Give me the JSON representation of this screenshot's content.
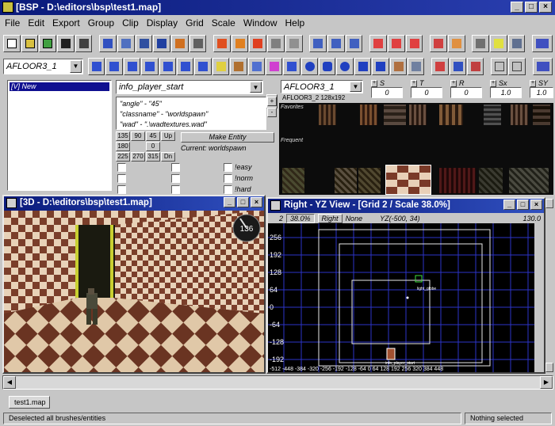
{
  "app": {
    "title": "[BSP - D:\\editors\\bsp\\test1.map]",
    "window_buttons": [
      "_",
      "□",
      "×"
    ]
  },
  "menu": [
    "File",
    "Edit",
    "Export",
    "Group",
    "Clip",
    "Display",
    "Grid",
    "Scale",
    "Window",
    "Help"
  ],
  "toolbar": {
    "texture_combo": "AFLOOR3_1"
  },
  "entity_panel": {
    "tree_item": "[V] New",
    "class_combo": "info_player_start",
    "properties": [
      "\"angle\" - \"45\"",
      "\"classname\" - \"worldspawn\"",
      "\"wad\" - \".\\wadtextures.wad\""
    ],
    "angle_buttons": [
      [
        "135",
        "90",
        "45",
        "Up"
      ],
      [
        "180",
        "",
        "0",
        ""
      ],
      [
        "225",
        "270",
        "315",
        "Dn"
      ]
    ],
    "make_entity": "Make Entity",
    "current": "Current:  worldspawn",
    "flags": [
      "!easy",
      "!norm",
      "!hard",
      "!dm"
    ]
  },
  "texture_panel": {
    "combo": "AFLOOR3_1",
    "info": "AFLOOR3_2 128x192",
    "favorites_label": "Favorites",
    "frequent_label": "Frequent",
    "fields": [
      {
        "label": "S",
        "value": "0"
      },
      {
        "label": "T",
        "value": "0"
      },
      {
        "label": "R",
        "value": "0"
      },
      {
        "label": "Sx",
        "value": "1.0"
      },
      {
        "label": "SY",
        "value": "1.0"
      }
    ]
  },
  "view3d": {
    "title": "[3D - D:\\editors\\bsp\\test1.map]",
    "compass": "136"
  },
  "view2d": {
    "title": "Right - YZ View - [Grid 2 / Scale  38.0%]",
    "toolbar": [
      "2",
      "38.0%",
      "Right",
      "None"
    ],
    "coords": "YZ(-500,   34)",
    "zoom": "130.0",
    "y_labels": [
      "256",
      "192",
      "128",
      "64",
      "0",
      "-64",
      "-128",
      "-192"
    ],
    "x_labels": "-512 -448 -384 -320 -256 -192 -128 -64   0    64   128  192  256  320  384  448",
    "label_a": "light_globe",
    "label_b": "info_player_start"
  },
  "tabs": [
    "test1.map"
  ],
  "status": {
    "left": "Deselected all brushes/entities",
    "right": "Nothing selected"
  },
  "colors": {
    "title_blue": "#0a1a7a",
    "grid_bg": "#000000",
    "grid_line": "#3a3ad8"
  }
}
